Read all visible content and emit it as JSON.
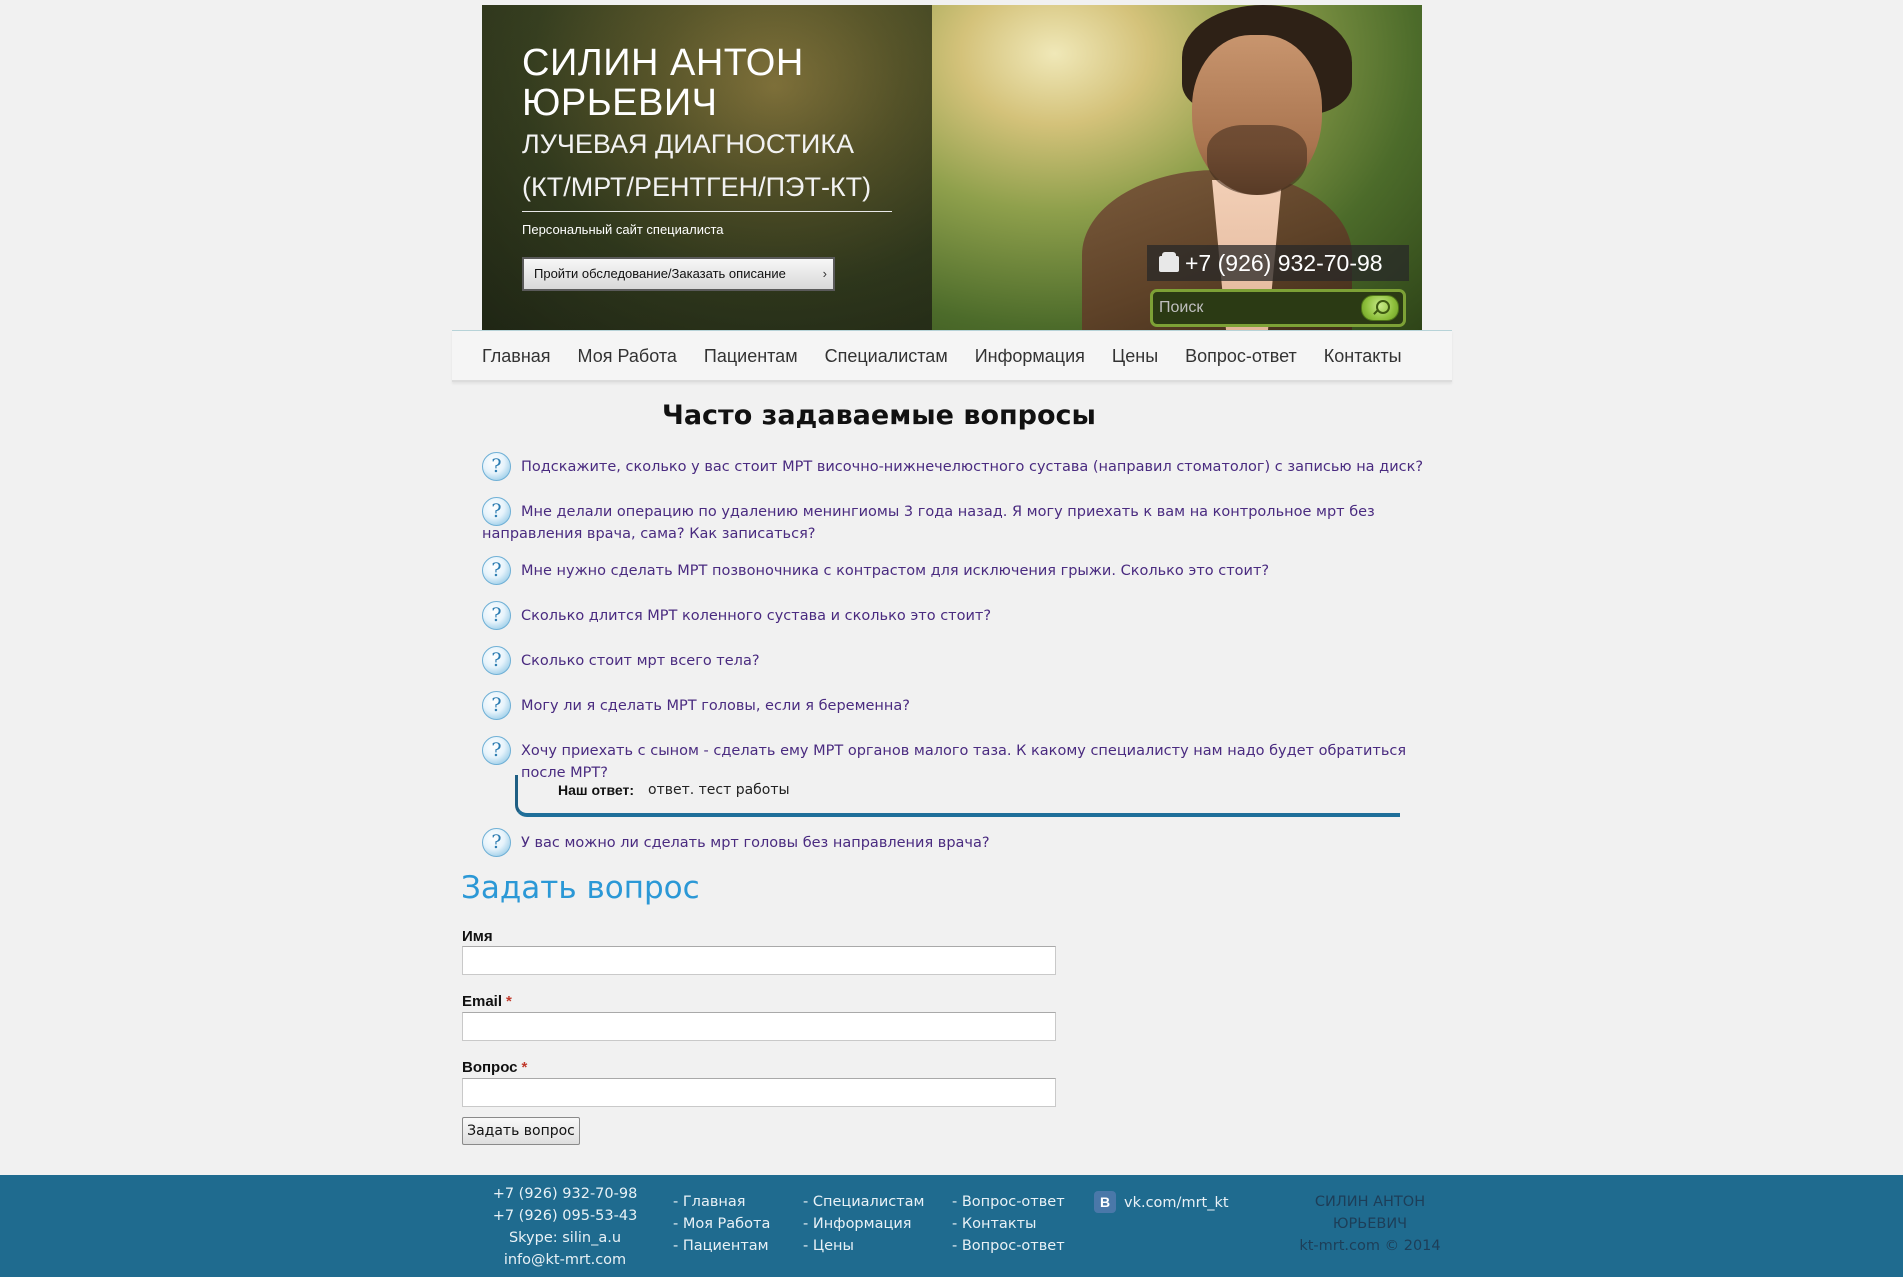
{
  "header": {
    "name_line1": "СИЛИН АНТОН",
    "name_line2": "ЮРЬЕВИЧ",
    "specialty_line1": "ЛУЧЕВАЯ ДИАГНОСТИКА",
    "specialty_line2": "(КТ/МРТ/РЕНТГЕН/ПЭТ-КТ)",
    "tagline": "Персональный сайт специалиста",
    "cta_label": "Пройти обследование/Заказать описание",
    "cta_arrow": "›",
    "phone": "+7 (926) 932-70-98",
    "search_placeholder": "Поиск"
  },
  "nav": {
    "items": [
      "Главная",
      "Моя Работа",
      "Пациентам",
      "Специалистам",
      "Информация",
      "Цены",
      "Вопрос-ответ",
      "Контакты"
    ]
  },
  "faq": {
    "title": "Часто задаваемые вопросы",
    "questions": [
      "Подскажите, сколько у вас стоит МРТ височно-нижнечелюстного сустава (направил стоматолог) с записью на диск?",
      "Мне делали операцию по удалению менингиомы 3 года назад. Я могу приехать к вам на контрольное мрт без направления врача, сама? Как записаться?",
      "Мне нужно сделать МРТ позвоночника с контрастом для исключения грыжи. Сколько это стоит?",
      "Сколько длится МРТ коленного сустава и сколько это стоит?",
      "Сколько стоит мрт всего тела?",
      "Могу ли я сделать МРТ головы, если я беременна?",
      "Хочу приехать с сыном - сделать ему МРТ органов малого таза. К какому специалисту нам надо будет обратиться после МРТ?",
      "У вас можно ли сделать мрт головы без направления врача?"
    ],
    "question_icon": "?",
    "answer_label": "Наш ответ:",
    "answer_text": "ответ. тест работы"
  },
  "ask_form": {
    "title": "Задать вопрос",
    "name_label": "Имя",
    "email_label": "Email",
    "question_label": "Вопрос",
    "required_mark": "*",
    "submit_label": "Задать вопрос"
  },
  "footer": {
    "phone1": "+7 (926) 932-70-98",
    "phone2": "+7 (926) 095-53-43",
    "skype": "Skype: silin_a.u",
    "email": "info@kt-mrt.com",
    "col1": [
      "- Главная",
      "- Моя Работа",
      "- Пациентам"
    ],
    "col2": [
      "- Специалистам",
      "- Информация",
      "- Цены"
    ],
    "col3": [
      "- Вопрос-ответ",
      "- Контакты",
      "- Вопрос-ответ"
    ],
    "vk_icon": "B",
    "vk_link": "vk.com/mrt_kt",
    "copy_line1": "СИЛИН АНТОН",
    "copy_line2": "ЮРЬЕВИЧ",
    "copy_line3": "kt-mrt.com © 2014"
  },
  "colors": {
    "page_bg": "#f1f1f1",
    "question_text": "#4a2b80",
    "ask_title": "#2b98d6",
    "footer_bg": "#1f6b8f",
    "answer_border": "#1f6f9a"
  }
}
